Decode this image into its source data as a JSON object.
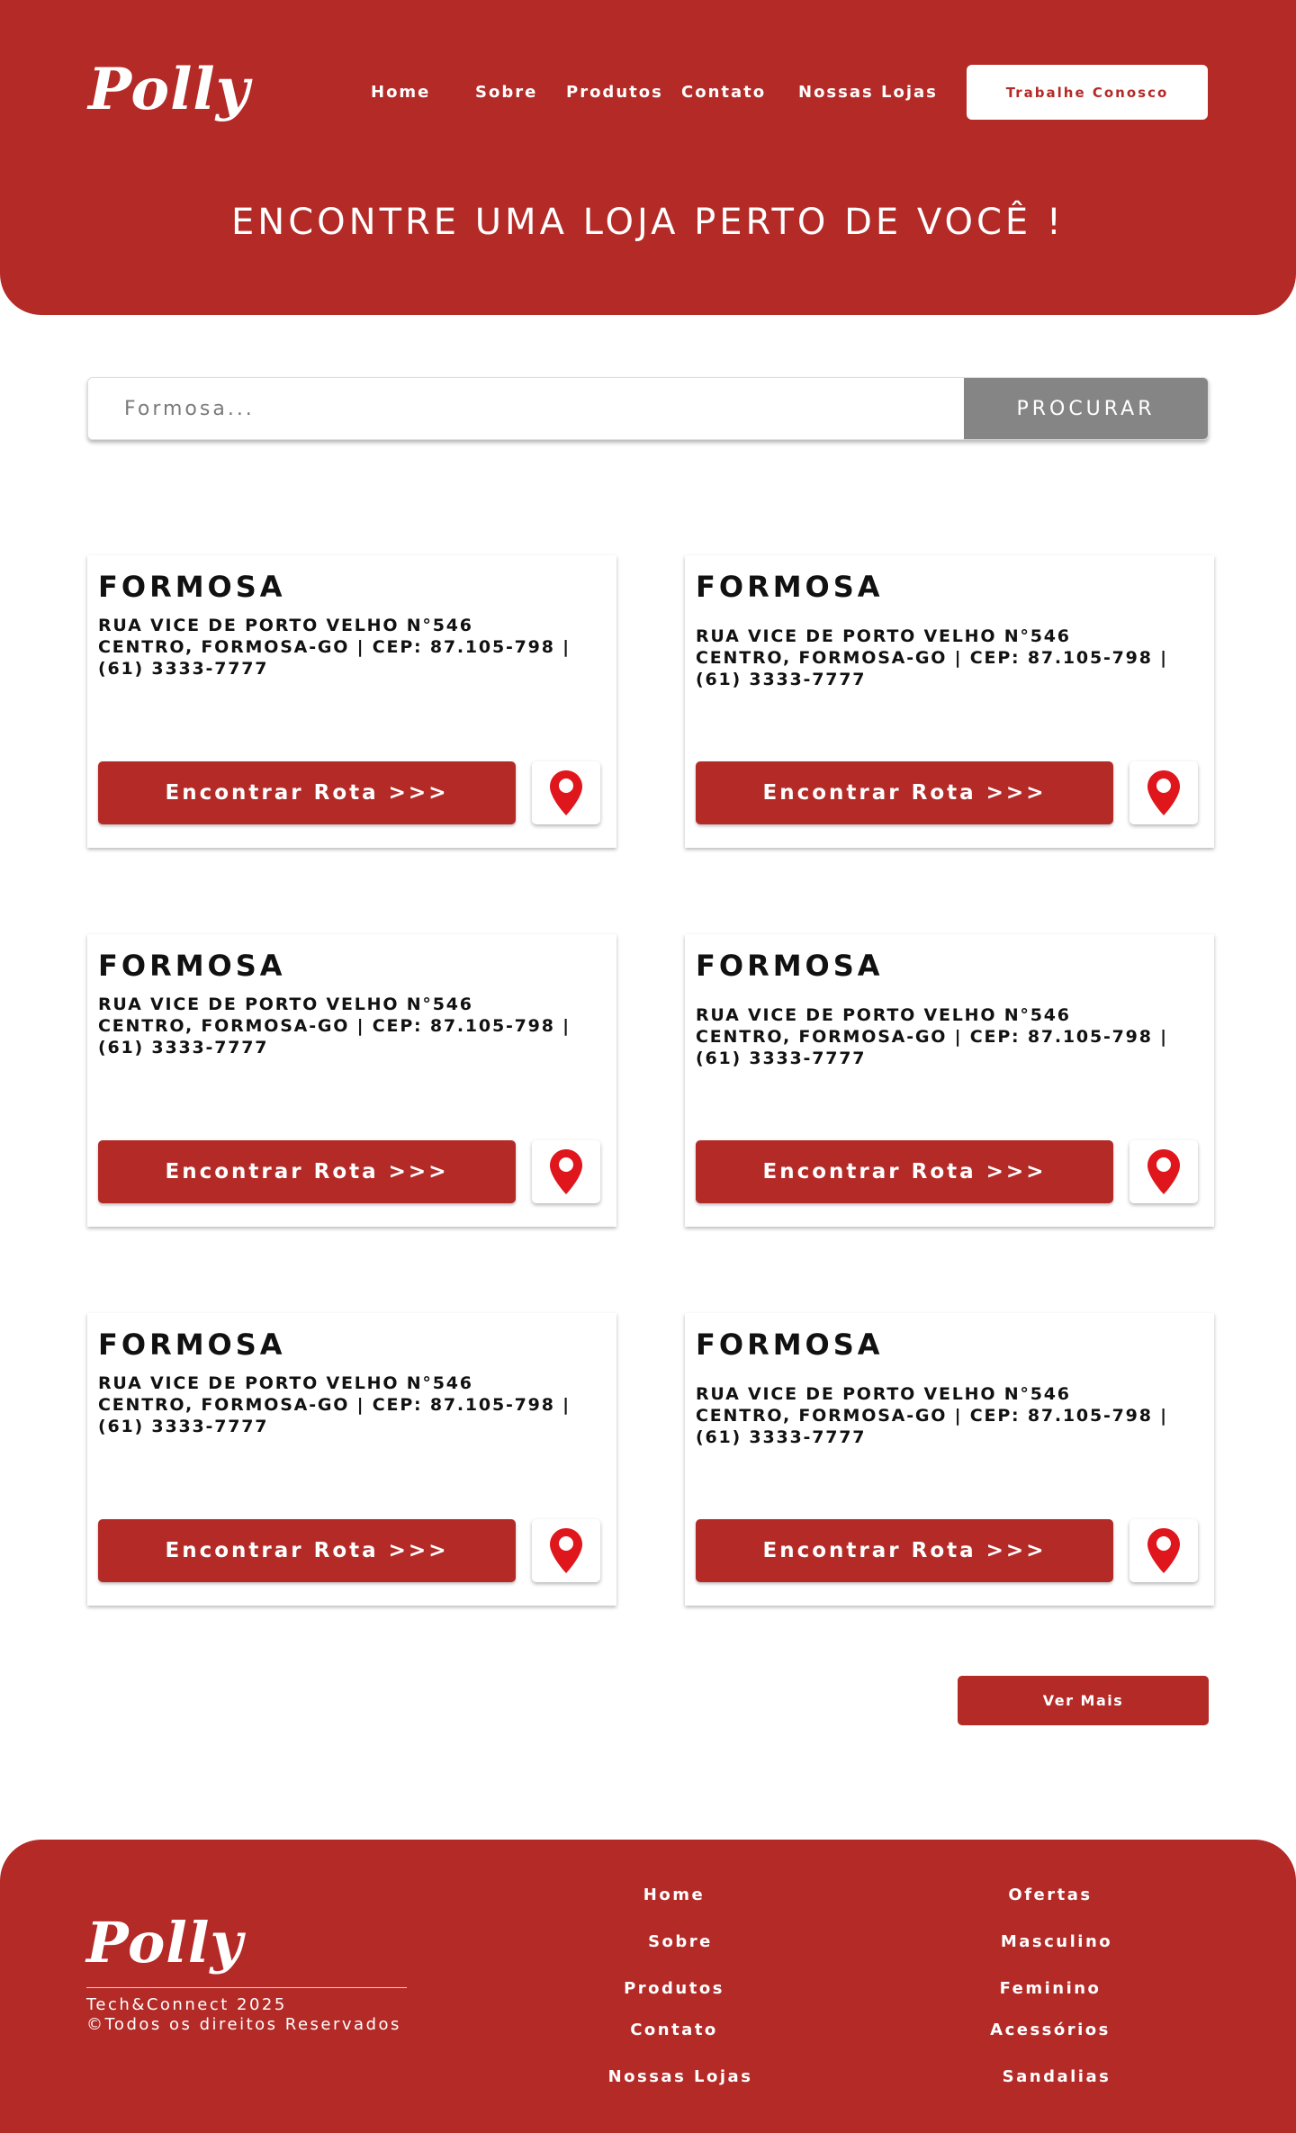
{
  "header": {
    "logo": "Polly",
    "nav": [
      "Home",
      "Sobre",
      "Produtos",
      "Contato",
      "Nossas Lojas"
    ],
    "cta_label": "Trabalhe Conosco",
    "hero_title": "ENCONTRE UMA LOJA PERTO DE VOCÊ !"
  },
  "search": {
    "placeholder": "Formosa...",
    "button_label": "PROCURAR"
  },
  "stores": [
    {
      "name": "FORMOSA",
      "address": "RUA VICE DE PORTO VELHO N°546 CENTRO, FORMOSA-GO | CEP: 87.105-798 | (61) 3333-7777",
      "route_label": "Encontrar Rota >>>"
    },
    {
      "name": "FORMOSA",
      "address": "RUA VICE DE PORTO VELHO N°546 CENTRO, FORMOSA-GO | CEP: 87.105-798 | (61) 3333-7777",
      "route_label": "Encontrar Rota >>>"
    },
    {
      "name": "FORMOSA",
      "address": "RUA VICE DE PORTO VELHO N°546 CENTRO, FORMOSA-GO | CEP: 87.105-798 | (61) 3333-7777",
      "route_label": "Encontrar Rota >>>"
    },
    {
      "name": "FORMOSA",
      "address": "RUA VICE DE PORTO VELHO N°546 CENTRO, FORMOSA-GO | CEP: 87.105-798 | (61) 3333-7777",
      "route_label": "Encontrar Rota >>>"
    },
    {
      "name": "FORMOSA",
      "address": "RUA VICE DE PORTO VELHO N°546 CENTRO, FORMOSA-GO | CEP: 87.105-798 | (61) 3333-7777",
      "route_label": "Encontrar Rota >>>"
    },
    {
      "name": "FORMOSA",
      "address": "RUA VICE DE PORTO VELHO N°546 CENTRO, FORMOSA-GO | CEP: 87.105-798 | (61) 3333-7777",
      "route_label": "Encontrar Rota >>>"
    }
  ],
  "pin_icon": "map-pin-icon",
  "more_label": "Ver Mais",
  "footer": {
    "logo": "Polly",
    "copyright_line1": "Tech&Connect 2025",
    "copyright_line2": "©Todos os direitos Reservados",
    "links_col1": [
      "Home",
      "Sobre",
      "Produtos",
      "Contato",
      "Nossas Lojas"
    ],
    "links_col2": [
      "Ofertas",
      "Masculino",
      "Feminino",
      "Acessórios",
      "Sandalias"
    ]
  },
  "colors": {
    "brand": "#b32a27",
    "pin": "#e0161d",
    "search_button": "#858585"
  }
}
